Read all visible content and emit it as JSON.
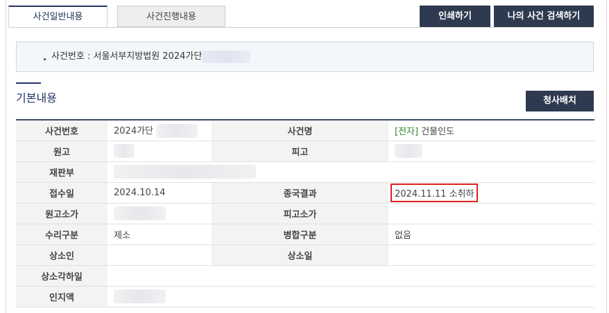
{
  "tabs": {
    "general": "사건일반내용",
    "progress": "사건진행내용"
  },
  "buttons": {
    "print": "인쇄하기",
    "my_search": "나의 사건 검색하기",
    "court_map": "청사배치"
  },
  "case_box": {
    "prefix": "사건번호 : ",
    "court_and_year": "서울서부지방법원 2024가단"
  },
  "section": {
    "title": "기본내용"
  },
  "table": {
    "rows": [
      {
        "l1": "사건번호",
        "v1": "2024가단",
        "l2": "사건명",
        "tag": "[전자]",
        "v2": "건물인도"
      },
      {
        "l1": "원고",
        "v1": "",
        "l2": "피고",
        "v2": ""
      },
      {
        "l1": "재판부",
        "v1": ""
      },
      {
        "l1": "접수일",
        "v1": "2024.10.14",
        "l2": "종국결과",
        "v2": "2024.11.11 소취하"
      },
      {
        "l1": "원고소가",
        "v1": "",
        "l2": "피고소가",
        "v2": ""
      },
      {
        "l1": "수리구분",
        "v1": "제소",
        "l2": "병합구분",
        "v2": "없음"
      },
      {
        "l1": "상소인",
        "v1": "",
        "l2": "상소일",
        "v2": ""
      },
      {
        "l1": "상소각하일",
        "v1": ""
      },
      {
        "l1": "인지액",
        "v1": ""
      }
    ]
  },
  "colors": {
    "accent": "#24346a",
    "button": "#2d3a4f",
    "highlight": "#e0201b",
    "tag_green": "#2e8b2e"
  }
}
